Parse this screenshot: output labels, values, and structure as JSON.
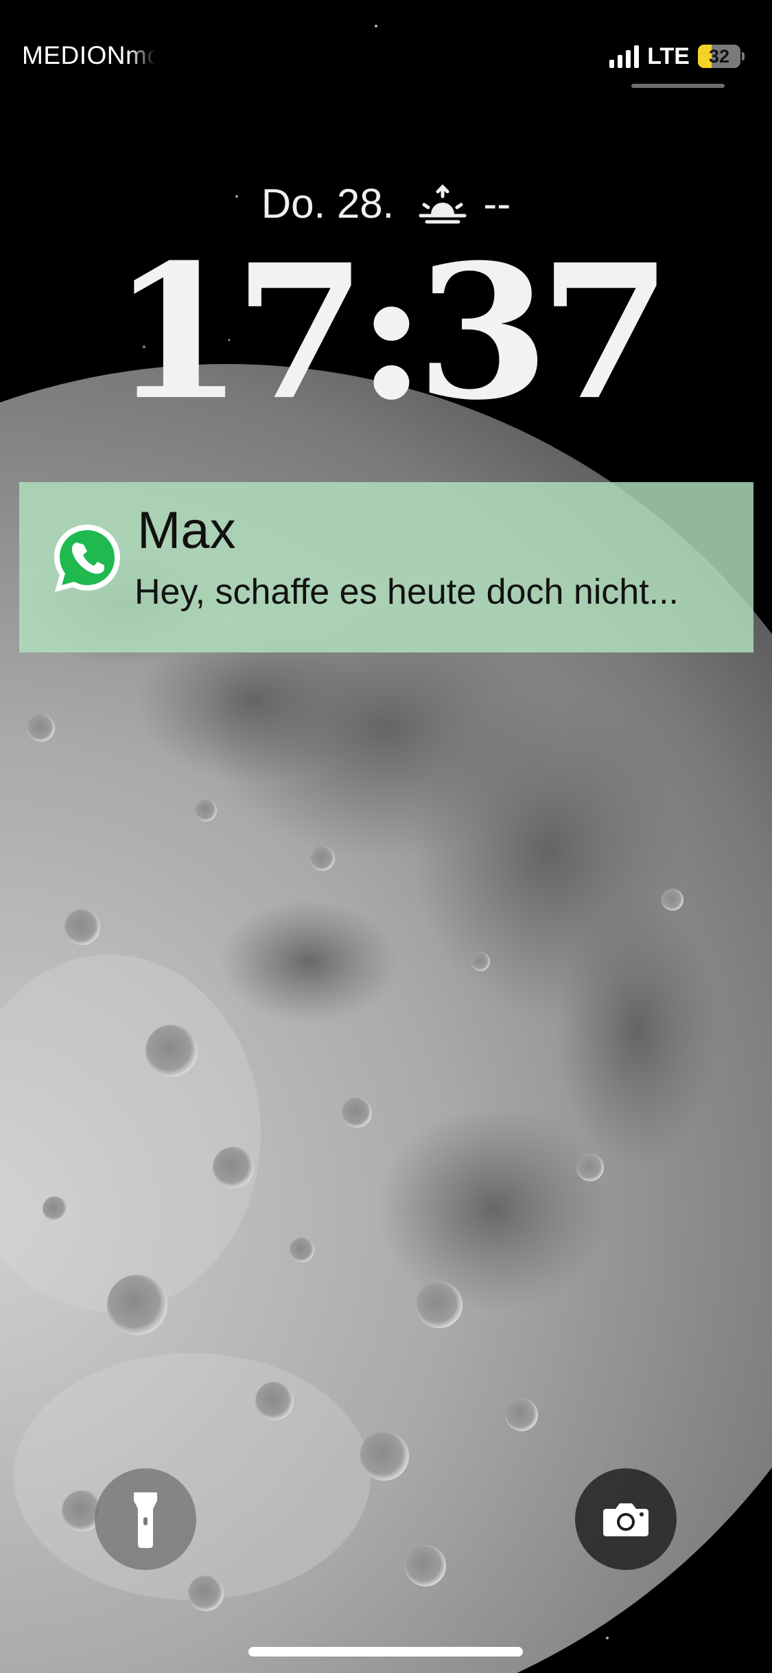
{
  "status_bar": {
    "carrier": "MEDIONmobile",
    "network": "LTE",
    "signal_bars": 4,
    "battery_level": "32",
    "battery_color": "#f5d326"
  },
  "lockscreen": {
    "date": "Do. 28.",
    "weather_icon": "sunrise-icon",
    "weather_value": "--",
    "time": "17:37"
  },
  "notification": {
    "app_icon": "whatsapp-icon",
    "title": "Max",
    "body": "Hey, schaffe es heute doch nicht...",
    "background": "#b2e0be"
  },
  "quick_actions": {
    "left_icon": "flashlight-icon",
    "right_icon": "camera-icon"
  },
  "wallpaper": {
    "subject": "moon"
  }
}
